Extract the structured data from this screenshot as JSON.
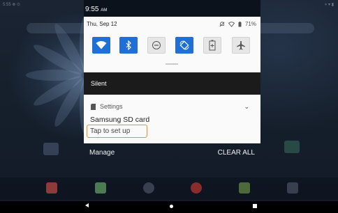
{
  "status_bar": {
    "left": "5:55 ⊕ ⊙",
    "right": "⋄ ▾ ▮"
  },
  "shade": {
    "time": "9:55",
    "ampm": "AM",
    "date": "Thu, Sep 12",
    "battery": "71%",
    "quick_settings": [
      {
        "name": "wifi",
        "state": "on",
        "icon": "wifi-icon"
      },
      {
        "name": "bluetooth",
        "state": "on",
        "icon": "bluetooth-icon"
      },
      {
        "name": "do-not-disturb",
        "state": "off",
        "icon": "dnd-icon"
      },
      {
        "name": "auto-rotate",
        "state": "on",
        "icon": "rotate-icon"
      },
      {
        "name": "battery-saver",
        "state": "off",
        "icon": "battery-saver-icon"
      },
      {
        "name": "airplane-mode",
        "state": "off",
        "icon": "airplane-icon"
      }
    ],
    "silent_label": "Silent",
    "notification": {
      "app": "Settings",
      "title": "Samsung SD card",
      "text": "Tap to set up"
    },
    "manage_label": "Manage",
    "clear_all_label": "CLEAR ALL"
  },
  "colors": {
    "accent": "#1f6fd6",
    "highlight": "#e8922e"
  }
}
